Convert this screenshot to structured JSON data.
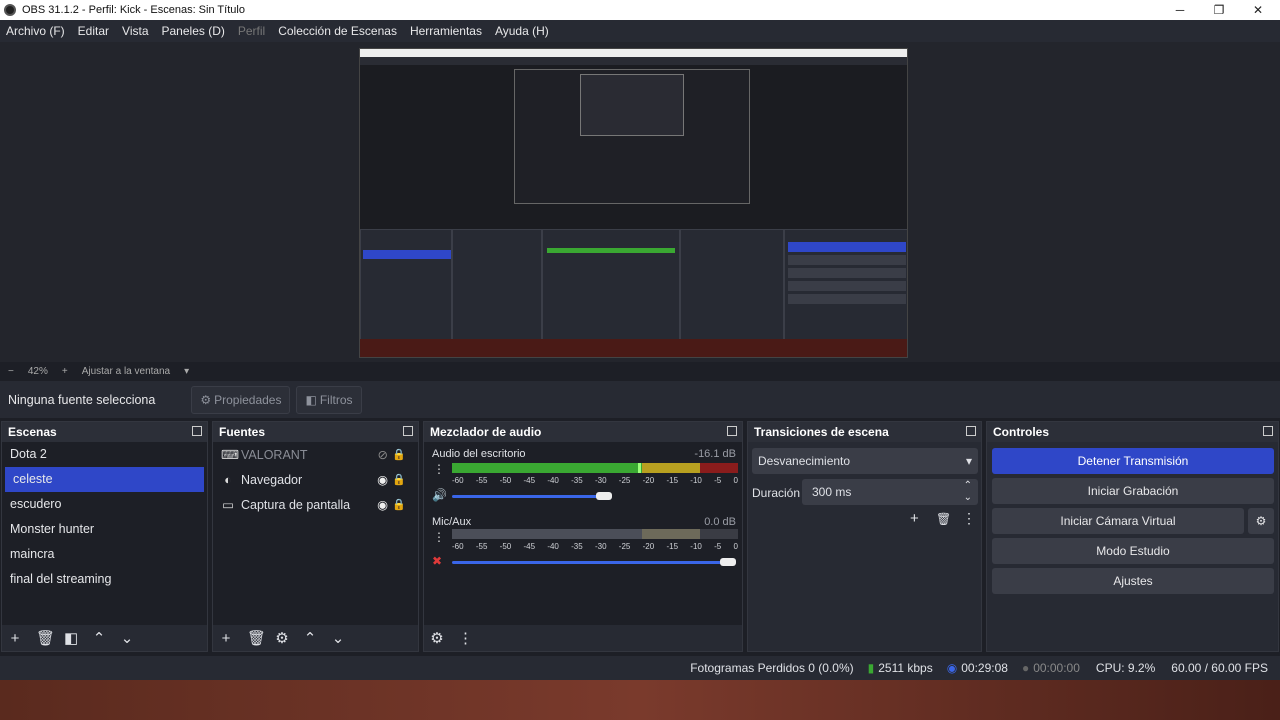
{
  "window": {
    "title": "OBS 31.1.2 - Perfil: Kick - Escenas: Sin Título",
    "minimize": "─",
    "maximize": "❐",
    "close": "✕"
  },
  "menu": {
    "items": [
      {
        "label": "Archivo (F)",
        "disabled": false
      },
      {
        "label": "Editar",
        "disabled": false
      },
      {
        "label": "Vista",
        "disabled": false
      },
      {
        "label": "Paneles (D)",
        "disabled": false
      },
      {
        "label": "Perfil",
        "disabled": true
      },
      {
        "label": "Colección de Escenas",
        "disabled": false
      },
      {
        "label": "Herramientas",
        "disabled": false
      },
      {
        "label": "Ayuda (H)",
        "disabled": false
      }
    ]
  },
  "zoom": {
    "minus": "−",
    "value": "42%",
    "plus": "+",
    "fit": "Ajustar a la ventana",
    "dropdown": "▾"
  },
  "source_toolbar": {
    "label": "Ninguna fuente selecciona",
    "properties": "Propiedades",
    "filters": "Filtros"
  },
  "scenes": {
    "title": "Escenas",
    "items": [
      "Dota 2",
      "celeste",
      "escudero",
      "Monster hunter",
      "maincra",
      "final del streaming"
    ],
    "selected_index": 1
  },
  "sources": {
    "title": "Fuentes",
    "items": [
      {
        "name": "VALORANT",
        "icon": "gamepad-icon",
        "visible": false
      },
      {
        "name": "Navegador",
        "icon": "globe-icon",
        "visible": true
      },
      {
        "name": "Captura de pantalla",
        "icon": "monitor-icon",
        "visible": true
      }
    ]
  },
  "mixer": {
    "title": "Mezclador de audio",
    "channels": [
      {
        "name": "Audio del escritorio",
        "db": "-16.1 dB",
        "volume": 0.96
      },
      {
        "name": "Mic/Aux",
        "db": "0.0 dB",
        "volume": 1.0
      }
    ],
    "ticks": [
      "-60",
      "-55",
      "-50",
      "-45",
      "-40",
      "-35",
      "-30",
      "-25",
      "-20",
      "-15",
      "-10",
      "-5",
      "0"
    ]
  },
  "transitions": {
    "title": "Transiciones de escena",
    "selected": "Desvanecimiento",
    "duration_label": "Duración",
    "duration_value": "300 ms"
  },
  "controls": {
    "title": "Controles",
    "buttons": [
      "Detener Transmisión",
      "Iniciar Grabación",
      "Iniciar Cámara Virtual",
      "Modo Estudio",
      "Ajustes"
    ]
  },
  "status": {
    "dropped": "Fotogramas Perdidos 0 (0.0%)",
    "bitrate": "2511 kbps",
    "stream_time": "00:29:08",
    "rec_time": "00:00:00",
    "cpu": "CPU: 9.2%",
    "fps": "60.00 / 60.00 FPS"
  },
  "colors": {
    "accent": "#2f47c8",
    "meter_green": "#3aa832",
    "meter_yellow": "#b8a020",
    "meter_red": "#b02020"
  }
}
